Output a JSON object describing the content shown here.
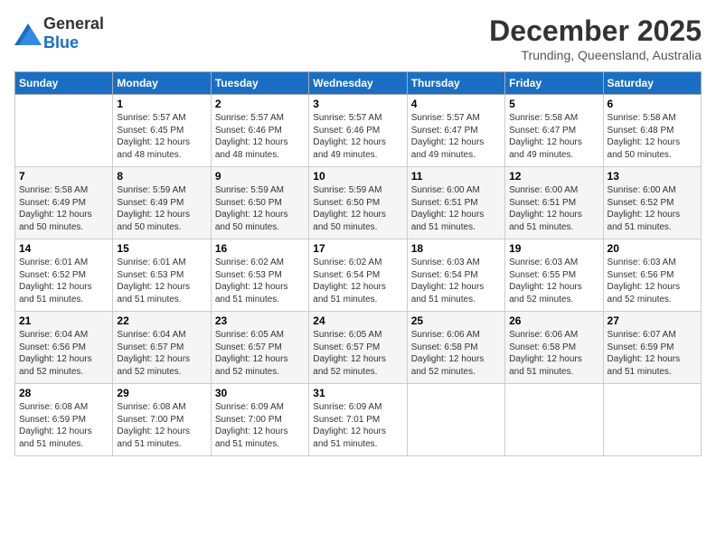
{
  "header": {
    "logo_general": "General",
    "logo_blue": "Blue",
    "month_title": "December 2025",
    "location": "Trunding, Queensland, Australia"
  },
  "days_of_week": [
    "Sunday",
    "Monday",
    "Tuesday",
    "Wednesday",
    "Thursday",
    "Friday",
    "Saturday"
  ],
  "weeks": [
    [
      {
        "day": "",
        "sunrise": "",
        "sunset": "",
        "daylight": ""
      },
      {
        "day": "1",
        "sunrise": "Sunrise: 5:57 AM",
        "sunset": "Sunset: 6:45 PM",
        "daylight": "Daylight: 12 hours and 48 minutes."
      },
      {
        "day": "2",
        "sunrise": "Sunrise: 5:57 AM",
        "sunset": "Sunset: 6:46 PM",
        "daylight": "Daylight: 12 hours and 48 minutes."
      },
      {
        "day": "3",
        "sunrise": "Sunrise: 5:57 AM",
        "sunset": "Sunset: 6:46 PM",
        "daylight": "Daylight: 12 hours and 49 minutes."
      },
      {
        "day": "4",
        "sunrise": "Sunrise: 5:57 AM",
        "sunset": "Sunset: 6:47 PM",
        "daylight": "Daylight: 12 hours and 49 minutes."
      },
      {
        "day": "5",
        "sunrise": "Sunrise: 5:58 AM",
        "sunset": "Sunset: 6:47 PM",
        "daylight": "Daylight: 12 hours and 49 minutes."
      },
      {
        "day": "6",
        "sunrise": "Sunrise: 5:58 AM",
        "sunset": "Sunset: 6:48 PM",
        "daylight": "Daylight: 12 hours and 50 minutes."
      }
    ],
    [
      {
        "day": "7",
        "sunrise": "Sunrise: 5:58 AM",
        "sunset": "Sunset: 6:49 PM",
        "daylight": "Daylight: 12 hours and 50 minutes."
      },
      {
        "day": "8",
        "sunrise": "Sunrise: 5:59 AM",
        "sunset": "Sunset: 6:49 PM",
        "daylight": "Daylight: 12 hours and 50 minutes."
      },
      {
        "day": "9",
        "sunrise": "Sunrise: 5:59 AM",
        "sunset": "Sunset: 6:50 PM",
        "daylight": "Daylight: 12 hours and 50 minutes."
      },
      {
        "day": "10",
        "sunrise": "Sunrise: 5:59 AM",
        "sunset": "Sunset: 6:50 PM",
        "daylight": "Daylight: 12 hours and 50 minutes."
      },
      {
        "day": "11",
        "sunrise": "Sunrise: 6:00 AM",
        "sunset": "Sunset: 6:51 PM",
        "daylight": "Daylight: 12 hours and 51 minutes."
      },
      {
        "day": "12",
        "sunrise": "Sunrise: 6:00 AM",
        "sunset": "Sunset: 6:51 PM",
        "daylight": "Daylight: 12 hours and 51 minutes."
      },
      {
        "day": "13",
        "sunrise": "Sunrise: 6:00 AM",
        "sunset": "Sunset: 6:52 PM",
        "daylight": "Daylight: 12 hours and 51 minutes."
      }
    ],
    [
      {
        "day": "14",
        "sunrise": "Sunrise: 6:01 AM",
        "sunset": "Sunset: 6:52 PM",
        "daylight": "Daylight: 12 hours and 51 minutes."
      },
      {
        "day": "15",
        "sunrise": "Sunrise: 6:01 AM",
        "sunset": "Sunset: 6:53 PM",
        "daylight": "Daylight: 12 hours and 51 minutes."
      },
      {
        "day": "16",
        "sunrise": "Sunrise: 6:02 AM",
        "sunset": "Sunset: 6:53 PM",
        "daylight": "Daylight: 12 hours and 51 minutes."
      },
      {
        "day": "17",
        "sunrise": "Sunrise: 6:02 AM",
        "sunset": "Sunset: 6:54 PM",
        "daylight": "Daylight: 12 hours and 51 minutes."
      },
      {
        "day": "18",
        "sunrise": "Sunrise: 6:03 AM",
        "sunset": "Sunset: 6:54 PM",
        "daylight": "Daylight: 12 hours and 51 minutes."
      },
      {
        "day": "19",
        "sunrise": "Sunrise: 6:03 AM",
        "sunset": "Sunset: 6:55 PM",
        "daylight": "Daylight: 12 hours and 52 minutes."
      },
      {
        "day": "20",
        "sunrise": "Sunrise: 6:03 AM",
        "sunset": "Sunset: 6:56 PM",
        "daylight": "Daylight: 12 hours and 52 minutes."
      }
    ],
    [
      {
        "day": "21",
        "sunrise": "Sunrise: 6:04 AM",
        "sunset": "Sunset: 6:56 PM",
        "daylight": "Daylight: 12 hours and 52 minutes."
      },
      {
        "day": "22",
        "sunrise": "Sunrise: 6:04 AM",
        "sunset": "Sunset: 6:57 PM",
        "daylight": "Daylight: 12 hours and 52 minutes."
      },
      {
        "day": "23",
        "sunrise": "Sunrise: 6:05 AM",
        "sunset": "Sunset: 6:57 PM",
        "daylight": "Daylight: 12 hours and 52 minutes."
      },
      {
        "day": "24",
        "sunrise": "Sunrise: 6:05 AM",
        "sunset": "Sunset: 6:57 PM",
        "daylight": "Daylight: 12 hours and 52 minutes."
      },
      {
        "day": "25",
        "sunrise": "Sunrise: 6:06 AM",
        "sunset": "Sunset: 6:58 PM",
        "daylight": "Daylight: 12 hours and 52 minutes."
      },
      {
        "day": "26",
        "sunrise": "Sunrise: 6:06 AM",
        "sunset": "Sunset: 6:58 PM",
        "daylight": "Daylight: 12 hours and 51 minutes."
      },
      {
        "day": "27",
        "sunrise": "Sunrise: 6:07 AM",
        "sunset": "Sunset: 6:59 PM",
        "daylight": "Daylight: 12 hours and 51 minutes."
      }
    ],
    [
      {
        "day": "28",
        "sunrise": "Sunrise: 6:08 AM",
        "sunset": "Sunset: 6:59 PM",
        "daylight": "Daylight: 12 hours and 51 minutes."
      },
      {
        "day": "29",
        "sunrise": "Sunrise: 6:08 AM",
        "sunset": "Sunset: 7:00 PM",
        "daylight": "Daylight: 12 hours and 51 minutes."
      },
      {
        "day": "30",
        "sunrise": "Sunrise: 6:09 AM",
        "sunset": "Sunset: 7:00 PM",
        "daylight": "Daylight: 12 hours and 51 minutes."
      },
      {
        "day": "31",
        "sunrise": "Sunrise: 6:09 AM",
        "sunset": "Sunset: 7:01 PM",
        "daylight": "Daylight: 12 hours and 51 minutes."
      },
      {
        "day": "",
        "sunrise": "",
        "sunset": "",
        "daylight": ""
      },
      {
        "day": "",
        "sunrise": "",
        "sunset": "",
        "daylight": ""
      },
      {
        "day": "",
        "sunrise": "",
        "sunset": "",
        "daylight": ""
      }
    ]
  ]
}
